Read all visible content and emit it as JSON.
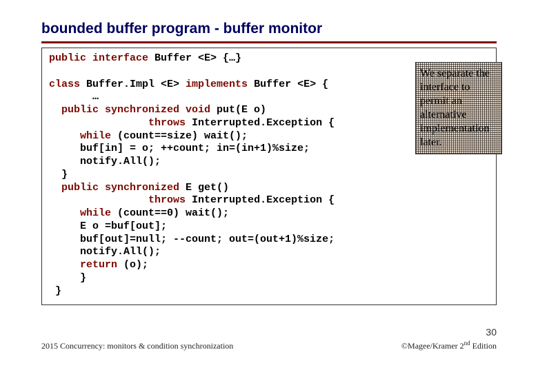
{
  "title": "bounded buffer program - buffer monitor",
  "code": {
    "l1a": "public interface",
    "l1b": " Buffer <E> {…}",
    "l2a": "class",
    "l2b": " Buffer.Impl <E> ",
    "l2c": "implements",
    "l2d": " Buffer <E> {",
    "l3": "       …",
    "l4a": "  public synchronized void",
    "l4b": " put(E o)",
    "l5a": "                throws",
    "l5b": " Interrupted.Exception {",
    "l6a": "     while",
    "l6b": " (count==size) wait();",
    "l7": "     buf[in] = o; ++count; in=(in+1)%size;",
    "l8": "     notify.All();",
    "l9": "  }",
    "l10a": "  public synchronized",
    "l10b": " E get()",
    "l11a": "                throws",
    "l11b": " Interrupted.Exception {",
    "l12a": "     while",
    "l12b": " (count==0) wait();",
    "l13": "     E o =buf[out];",
    "l14": "     buf[out]=null; --count; out=(out+1)%size;",
    "l15": "     notify.All();",
    "l16a": "     return",
    "l16b": " (o);",
    "l17": "     }",
    "l18": " }"
  },
  "callout": "We separate the interface to permit an alternative implementation later.",
  "page_number": "30",
  "footer_left": "2015  Concurrency: monitors & condition synchronization",
  "footer_right_a": "©Magee/Kramer 2",
  "footer_right_b": "nd",
  "footer_right_c": " Edition"
}
